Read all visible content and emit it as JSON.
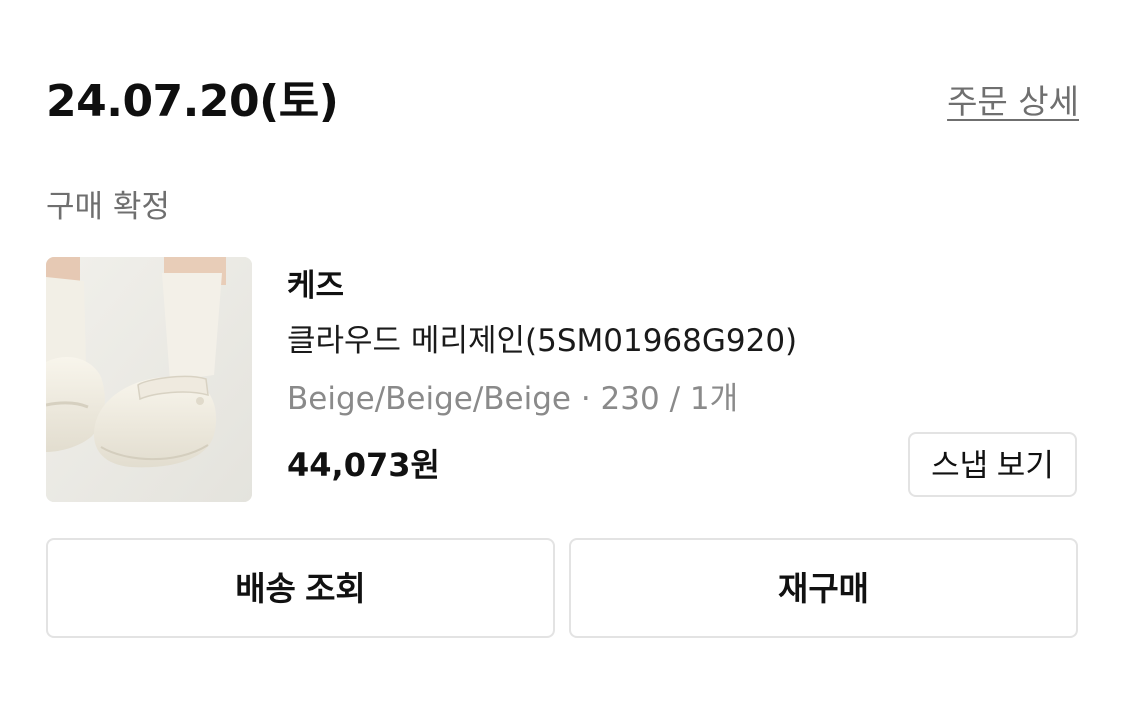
{
  "order": {
    "date": "24.07.20(토)",
    "detail_link_label": "주문 상세",
    "status": "구매 확정"
  },
  "product": {
    "brand": "케즈",
    "name": "클라우드 메리제인(5SM01968G920)",
    "option": "Beige/Beige/Beige · 230 / 1개",
    "price": "44,073원",
    "image_icon": "product-photo",
    "snap_button_label": "스냅 보기"
  },
  "actions": {
    "tracking_label": "배송 조회",
    "rebuy_label": "재구매"
  },
  "colors": {
    "text_primary": "#111111",
    "text_secondary": "#6f6f6f",
    "text_muted": "#8a8a8a",
    "border": "#e3e3e3"
  }
}
